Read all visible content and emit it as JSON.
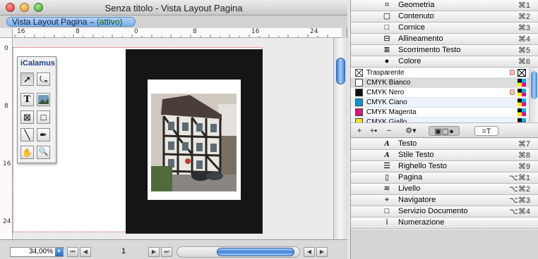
{
  "window": {
    "title": "Senza titolo - Vista Layout Pagina",
    "tab_label": "Vista Layout Pagina – ",
    "tab_state": "(attivo)"
  },
  "ruler": {
    "h_labels": [
      "16",
      "8",
      "0",
      "8",
      "16",
      "24"
    ],
    "v_labels": [
      "0",
      "8",
      "16",
      "24"
    ]
  },
  "toolbox": {
    "title": "iCalamus",
    "tools": [
      {
        "name": "arrow-tool-icon",
        "glyph": "➚"
      },
      {
        "name": "rotate-tool-icon",
        "glyph": "⤿"
      },
      {
        "name": "text-tool-icon",
        "glyph": "T"
      },
      {
        "name": "image-tool-icon",
        "glyph": ""
      },
      {
        "name": "frame-cross-tool-icon",
        "glyph": "⊠"
      },
      {
        "name": "rectangle-tool-icon",
        "glyph": "□"
      },
      {
        "name": "line-tool-icon",
        "glyph": "╲"
      },
      {
        "name": "pen-tool-icon",
        "glyph": "✒"
      },
      {
        "name": "hand-tool-icon",
        "glyph": "✋"
      },
      {
        "name": "zoom-tool-icon",
        "glyph": "🔍"
      }
    ]
  },
  "status": {
    "zoom": "34,00%",
    "page": "1"
  },
  "panel": {
    "top_items": [
      {
        "label": "Geometria",
        "shortcut": "⌘1",
        "icon": "geometry-icon",
        "glyph": "⌗"
      },
      {
        "label": "Contenuto",
        "shortcut": "⌘2",
        "icon": "content-icon",
        "glyph": "▢"
      },
      {
        "label": "Cornice",
        "shortcut": "⌘3",
        "icon": "frame-icon",
        "glyph": "□"
      },
      {
        "label": "Allineamento",
        "shortcut": "⌘4",
        "icon": "alignment-icon",
        "glyph": "⊟"
      },
      {
        "label": "Scorrimento Testo",
        "shortcut": "⌘5",
        "icon": "text-flow-icon",
        "glyph": "≣"
      },
      {
        "label": "Colore",
        "shortcut": "⌘6",
        "icon": "color-palette-icon",
        "glyph": "●"
      }
    ],
    "colors": [
      {
        "name": "Trasparente",
        "swatch": "transparent",
        "lock": true,
        "mode": "none"
      },
      {
        "name": "CMYK Bianco",
        "swatch": "#ffffff",
        "lock": false,
        "mode": "cmyk"
      },
      {
        "name": "CMYK Nero",
        "swatch": "#111111",
        "lock": true,
        "mode": "cmyk"
      },
      {
        "name": "CMYK Ciano",
        "swatch": "#0a94d6",
        "lock": false,
        "mode": "cmyk"
      },
      {
        "name": "CMYK Magenta",
        "swatch": "#d7157a",
        "lock": false,
        "mode": "cmyk"
      },
      {
        "name": "CMYK Giallo",
        "swatch": "#f4e21b",
        "lock": false,
        "mode": "cmyk"
      }
    ],
    "color_tools": [
      "+",
      "+▪",
      "−",
      "⚙▾",
      "▣▢●",
      "⌗T"
    ],
    "bottom_items": [
      {
        "label": "Testo",
        "shortcut": "⌘7",
        "icon": "text-icon",
        "glyph": "A"
      },
      {
        "label": "Stile Testo",
        "shortcut": "⌘8",
        "icon": "text-style-icon",
        "glyph": "A"
      },
      {
        "label": "Righello Testo",
        "shortcut": "⌘9",
        "icon": "text-ruler-icon",
        "glyph": "☰"
      },
      {
        "label": "Pagina",
        "shortcut": "⌥⌘1",
        "icon": "page-icon",
        "glyph": "▯"
      },
      {
        "label": "Livello",
        "shortcut": "⌥⌘2",
        "icon": "layer-icon",
        "glyph": "≋"
      },
      {
        "label": "Navigatore",
        "shortcut": "⌥⌘3",
        "icon": "navigator-icon",
        "glyph": "⌖"
      },
      {
        "label": "Servizio Documento",
        "shortcut": "⌥⌘4",
        "icon": "document-service-icon",
        "glyph": "□"
      },
      {
        "label": "Numerazione",
        "shortcut": "",
        "icon": "numbering-icon",
        "glyph": "ī"
      }
    ]
  },
  "colors": {
    "accent": "#3f80d6",
    "close": "#e0443e",
    "minimize": "#e8a827",
    "zoom": "#4fb33a"
  }
}
